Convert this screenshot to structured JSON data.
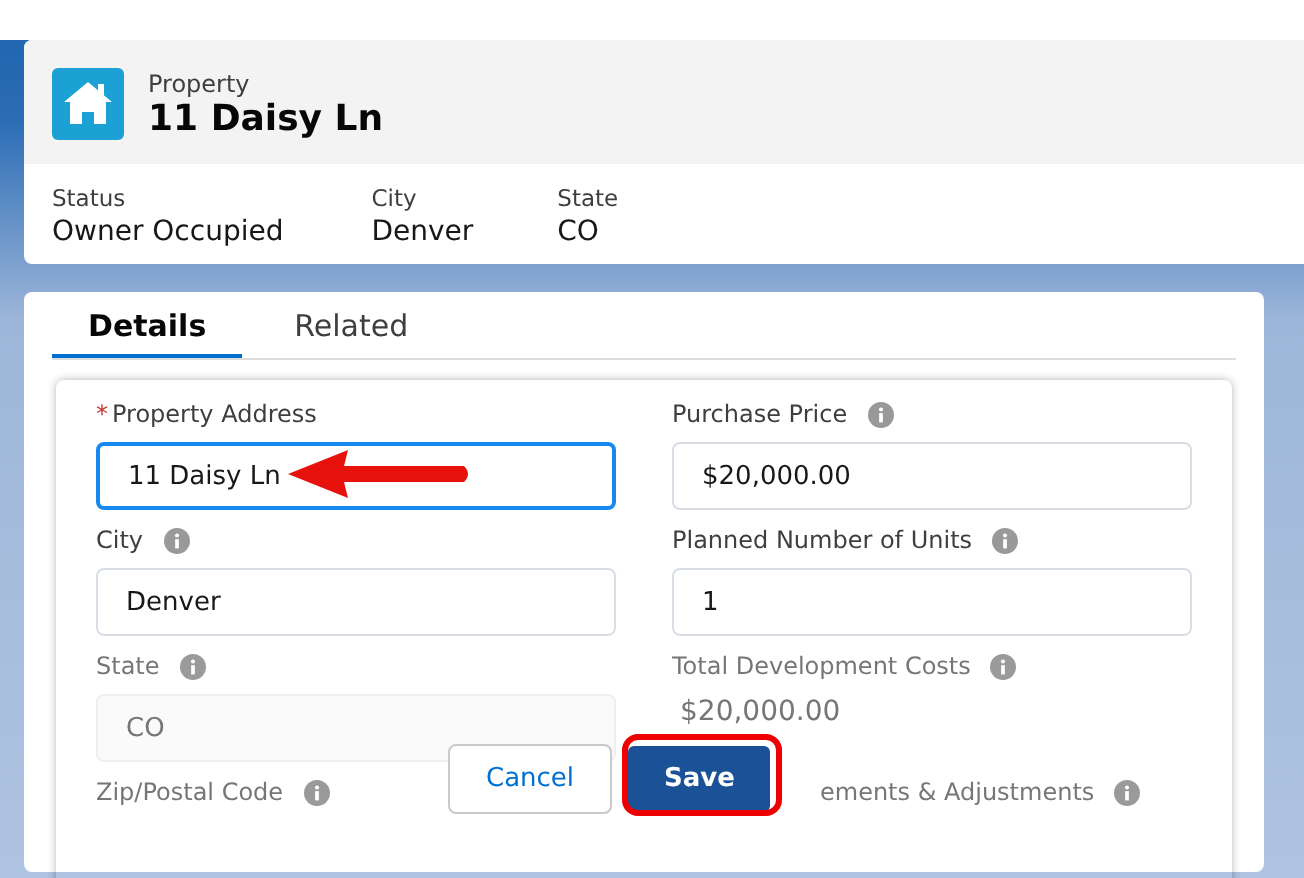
{
  "record": {
    "object": "Property",
    "title": "11 Daisy Ln"
  },
  "highlights": [
    {
      "label": "Status",
      "value": "Owner Occupied"
    },
    {
      "label": "City",
      "value": "Denver"
    },
    {
      "label": "State",
      "value": "CO"
    }
  ],
  "tabs": [
    {
      "label": "Details",
      "selected": true
    },
    {
      "label": "Related",
      "selected": false
    }
  ],
  "fields": [
    {
      "label": "Property Address",
      "required_mark": "*",
      "info": false,
      "value": "11 Daisy Ln",
      "focused": true,
      "disabled": false,
      "kind": "input"
    },
    {
      "label": "Purchase Price",
      "info": true,
      "value": "$20,000.00",
      "focused": false,
      "disabled": false,
      "kind": "input"
    },
    {
      "label": "City",
      "info": true,
      "value": "Denver",
      "focused": false,
      "disabled": false,
      "kind": "input"
    },
    {
      "label": "Planned Number of Units",
      "info": true,
      "value": "1",
      "focused": false,
      "disabled": false,
      "kind": "input"
    },
    {
      "label": "State",
      "info": true,
      "value": "CO",
      "focused": false,
      "disabled": true,
      "kind": "input"
    },
    {
      "label": "Total Development Costs",
      "info": true,
      "value": "$20,000.00",
      "disabled": true,
      "kind": "readonly"
    },
    {
      "label": "Zip/Postal Code",
      "info": true,
      "disabled": true,
      "kind": "label"
    },
    {
      "label": "ements & Adjustments",
      "info": true,
      "disabled": true,
      "kind": "partial"
    }
  ],
  "footer": {
    "cancel": "Cancel",
    "save": "Save"
  }
}
